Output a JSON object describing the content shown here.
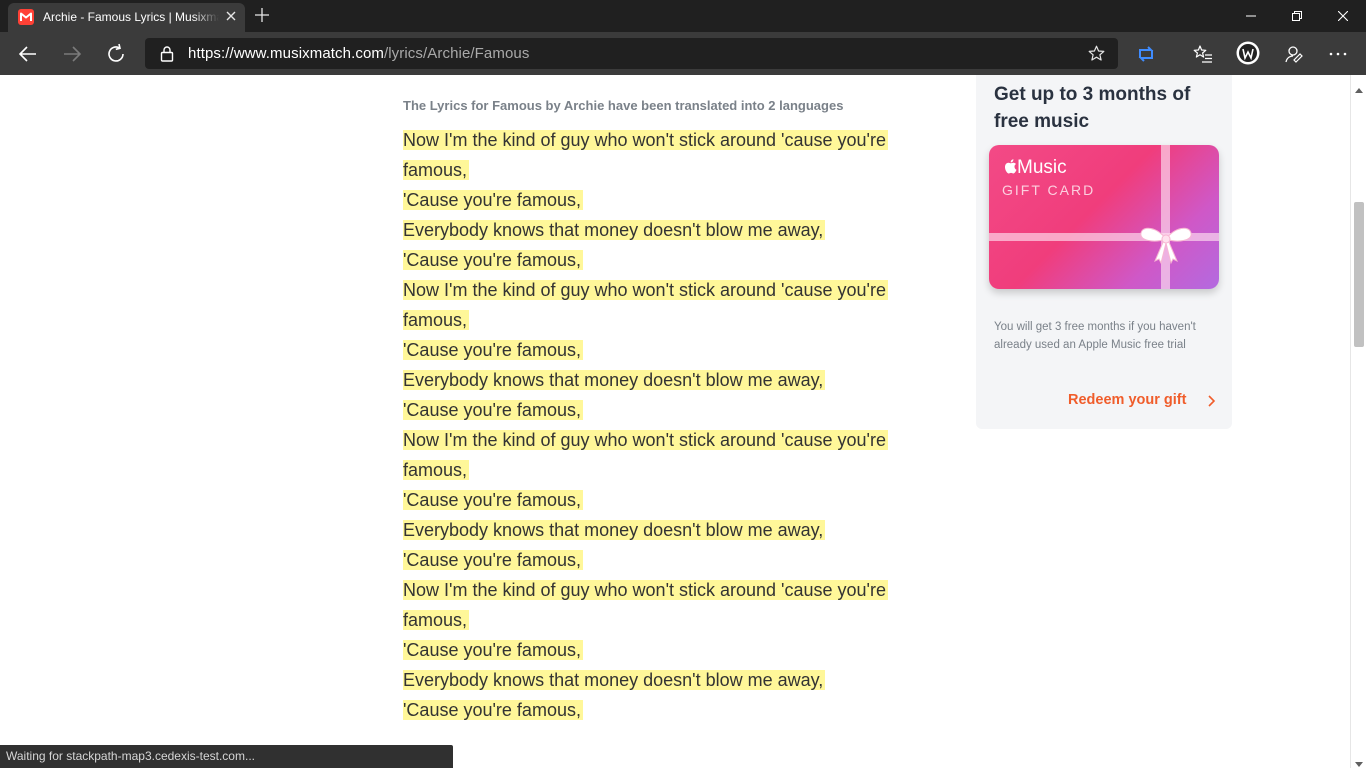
{
  "browser": {
    "tab_title": "Archie - Famous Lyrics | Musixmatch",
    "url_host": "https://www.musixmatch.com",
    "url_path": "/lyrics/Archie/Famous",
    "status": "Waiting for stackpath-map3.cedexis-test.com..."
  },
  "page": {
    "translated_note": "The Lyrics for Famous by Archie have been translated into 2 languages",
    "lyrics": [
      "Now I'm the kind of guy who won't stick around 'cause you're",
      "famous,",
      "'Cause you're famous,",
      "Everybody knows that money doesn't blow me away,",
      "'Cause you're famous,",
      "Now I'm the kind of guy who won't stick around 'cause you're",
      "famous,",
      "'Cause you're famous,",
      "Everybody knows that money doesn't blow me away,",
      "'Cause you're famous,",
      "Now I'm the kind of guy who won't stick around 'cause you're",
      "famous,",
      "'Cause you're famous,",
      "Everybody knows that money doesn't blow me away,",
      "'Cause you're famous,",
      "Now I'm the kind of guy who won't stick around 'cause you're",
      "famous,",
      "'Cause you're famous,",
      "Everybody knows that money doesn't blow me away,",
      "'Cause you're famous,"
    ],
    "highlight_color": "#fff799"
  },
  "promo": {
    "title": "Get up to 3 months of free music",
    "card_brand": "Music",
    "card_sub": "GIFT CARD",
    "note": "You will get 3 free months if you haven't already used an Apple Music free trial",
    "cta": "Redeem your gift",
    "cta_color": "#f05d2b"
  },
  "icons": [
    "musixmatch-favicon",
    "close-icon",
    "plus-icon",
    "minimize-icon",
    "restore-icon",
    "window-close-icon",
    "back-arrow-icon",
    "forward-arrow-icon",
    "refresh-icon",
    "lock-icon",
    "star-icon",
    "extension-icon",
    "favorites-icon",
    "profile-avatar-icon",
    "feedback-icon",
    "more-icon",
    "apple-icon",
    "bow-icon",
    "chevron-right-icon"
  ]
}
